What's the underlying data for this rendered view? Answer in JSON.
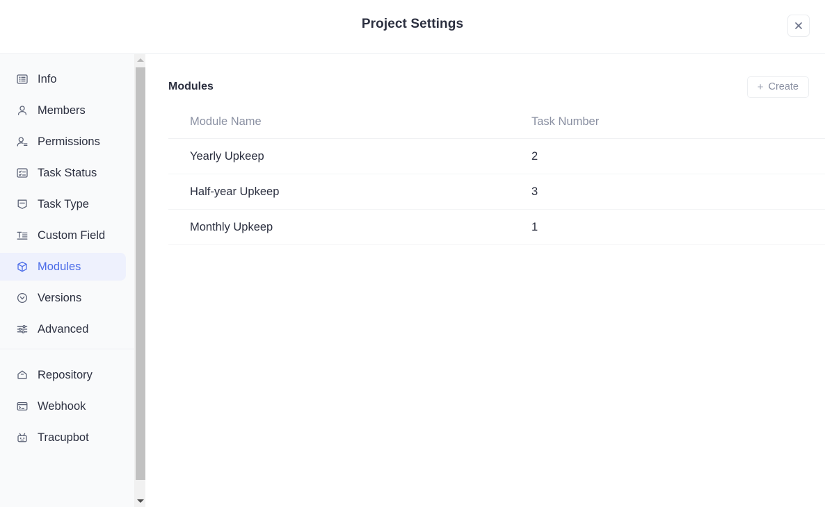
{
  "header": {
    "title": "Project Settings",
    "close_icon": "close-icon"
  },
  "colors": {
    "accent": "#4b6ce8",
    "accent_bg": "#eef1fd",
    "sidebar_bg": "#f9fafb",
    "text": "#2c3040",
    "muted_text": "#8a90a2",
    "border": "#f0f1f3"
  },
  "sidebar": {
    "groups": [
      {
        "items": [
          {
            "label": "Info",
            "icon": "list-box-icon",
            "active": false
          },
          {
            "label": "Members",
            "icon": "person-icon",
            "active": false
          },
          {
            "label": "Permissions",
            "icon": "person-lines-icon",
            "active": false
          },
          {
            "label": "Task Status",
            "icon": "checklist-icon",
            "active": false
          },
          {
            "label": "Task Type",
            "icon": "bookmark-icon",
            "active": false
          },
          {
            "label": "Custom Field",
            "icon": "text-format-icon",
            "active": false
          },
          {
            "label": "Modules",
            "icon": "cube-icon",
            "active": true
          },
          {
            "label": "Versions",
            "icon": "circle-chevron-down-icon",
            "active": false
          },
          {
            "label": "Advanced",
            "icon": "sliders-icon",
            "active": false
          }
        ]
      },
      {
        "items": [
          {
            "label": "Repository",
            "icon": "repository-icon",
            "active": false
          },
          {
            "label": "Webhook",
            "icon": "terminal-icon",
            "active": false
          },
          {
            "label": "Tracupbot",
            "icon": "robot-icon",
            "active": false
          }
        ]
      }
    ],
    "scrollbar": {
      "up_icon": "scroll-up-arrow-icon",
      "down_icon": "scroll-down-arrow-icon",
      "thumb": "scrollbar-thumb"
    }
  },
  "main": {
    "section_title": "Modules",
    "create_button": {
      "label": "Create",
      "icon": "plus-icon"
    },
    "table": {
      "columns": [
        "Module Name",
        "Task Number"
      ],
      "rows": [
        {
          "name": "Yearly Upkeep",
          "tasks": "2"
        },
        {
          "name": "Half-year Upkeep",
          "tasks": "3"
        },
        {
          "name": "Monthly Upkeep",
          "tasks": "1"
        }
      ]
    }
  }
}
